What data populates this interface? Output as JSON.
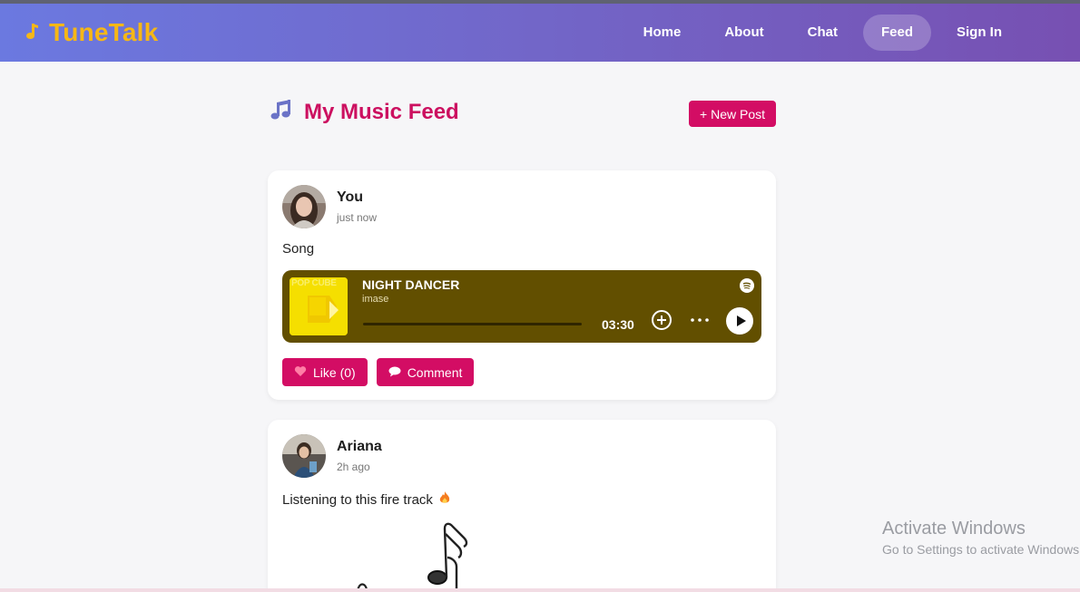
{
  "brand": {
    "icon": "music-note-icon",
    "title": "TuneTalk",
    "color": "#f6b716"
  },
  "nav": {
    "items": [
      "Home",
      "About",
      "Chat",
      "Feed",
      "Sign In"
    ],
    "active": "Feed"
  },
  "feed": {
    "title": "My Music Feed",
    "icon": "music-notes-icon",
    "new_post_label": "+ New Post"
  },
  "posts": [
    {
      "user": "You",
      "time": "just now",
      "text": "Song",
      "player": {
        "cover_text": "POP CUBE",
        "track": "NIGHT DANCER",
        "artist": "imase",
        "duration": "03:30",
        "progress": 0,
        "provider_icon": "spotify-icon"
      },
      "like_label": "Like (0)",
      "comment_label": "Comment"
    },
    {
      "user": "Ariana",
      "time": "2h ago",
      "text": "Listening to this fire track",
      "emoji_icon": "fire-icon"
    }
  ],
  "watermark": {
    "title": "Activate Windows",
    "subtitle": "Go to Settings to activate Windows."
  },
  "colors": {
    "accent": "#d30d64",
    "title": "#cc1060",
    "player_bg": "#624f00"
  }
}
